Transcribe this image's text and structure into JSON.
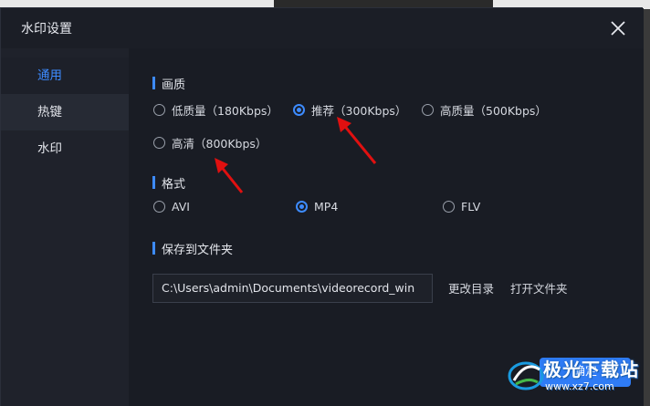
{
  "window": {
    "title": "水印设置"
  },
  "sidebar": {
    "items": [
      {
        "label": "通用",
        "active": true
      },
      {
        "label": "热键",
        "active": false
      },
      {
        "label": "水印",
        "active": false
      }
    ]
  },
  "quality": {
    "title": "画质",
    "options": [
      {
        "label": "低质量（180Kbps）",
        "checked": false
      },
      {
        "label": "推荐（300Kbps）",
        "checked": true
      },
      {
        "label": "高质量（500Kbps）",
        "checked": false
      },
      {
        "label": "高清（800Kbps）",
        "checked": false
      }
    ]
  },
  "format": {
    "title": "格式",
    "options": [
      {
        "label": "AVI",
        "checked": false
      },
      {
        "label": "MP4",
        "checked": true
      },
      {
        "label": "FLV",
        "checked": false
      }
    ]
  },
  "save": {
    "title": "保存到文件夹",
    "path": "C:\\Users\\admin\\Documents\\videorecord_win",
    "change_label": "更改目录",
    "open_label": "打开文件夹"
  },
  "footer": {
    "confirm_label": "确定"
  },
  "watermark": {
    "brand": "极光下载站",
    "url": "www.xz7.com"
  },
  "colors": {
    "accent": "#3d8bff",
    "button": "#2f7cf6",
    "arrow": "#e01010"
  }
}
